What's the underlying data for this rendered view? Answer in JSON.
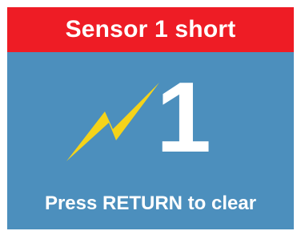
{
  "alert": {
    "title": "Sensor 1 short",
    "icon": "lightning-bolt-icon",
    "sensor_number": "1",
    "instruction": "Press RETURN to clear"
  },
  "colors": {
    "header_background": "#ee1c25",
    "panel_background": "#4c8fbd",
    "text": "#ffffff",
    "bolt": "#f5d31a"
  }
}
